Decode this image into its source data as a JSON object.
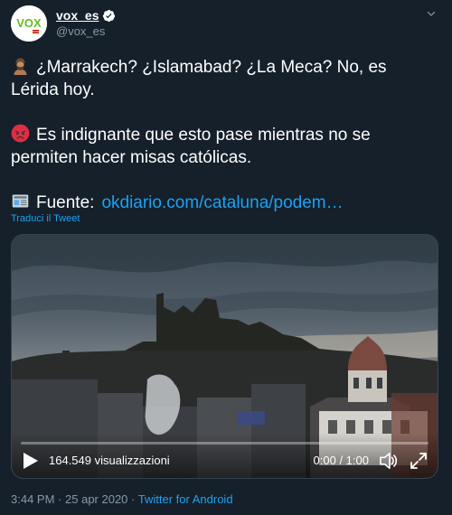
{
  "author": {
    "display_name": "vox_es",
    "handle": "@vox_es",
    "avatar_text": "VOX",
    "verified": true
  },
  "tweet": {
    "paragraphs": [
      {
        "emoji": "person-wearing-turban",
        "text": "¿Marrakech? ¿Islamabad? ¿La Meca? No, es Lérida hoy."
      },
      {
        "emoji": "angry-face",
        "text": "Es indignante que esto pase mientras no se permiten hacer misas católicas."
      },
      {
        "emoji": "newspaper",
        "text": "Fuente:",
        "link": "okdiario.com/cataluna/podem…"
      }
    ],
    "translate_label": "Traduci il Tweet"
  },
  "video": {
    "views": "164.549 visualizzazioni",
    "time": "0:00 / 1:00",
    "progress": 0
  },
  "meta": {
    "time": "3:44 PM",
    "date": "25 apr 2020",
    "separator": "·",
    "source": "Twitter for Android"
  },
  "colors": {
    "background": "#15202b",
    "link": "#1da1f2",
    "secondary_text": "#8899a6",
    "brand_green": "#63be21"
  }
}
